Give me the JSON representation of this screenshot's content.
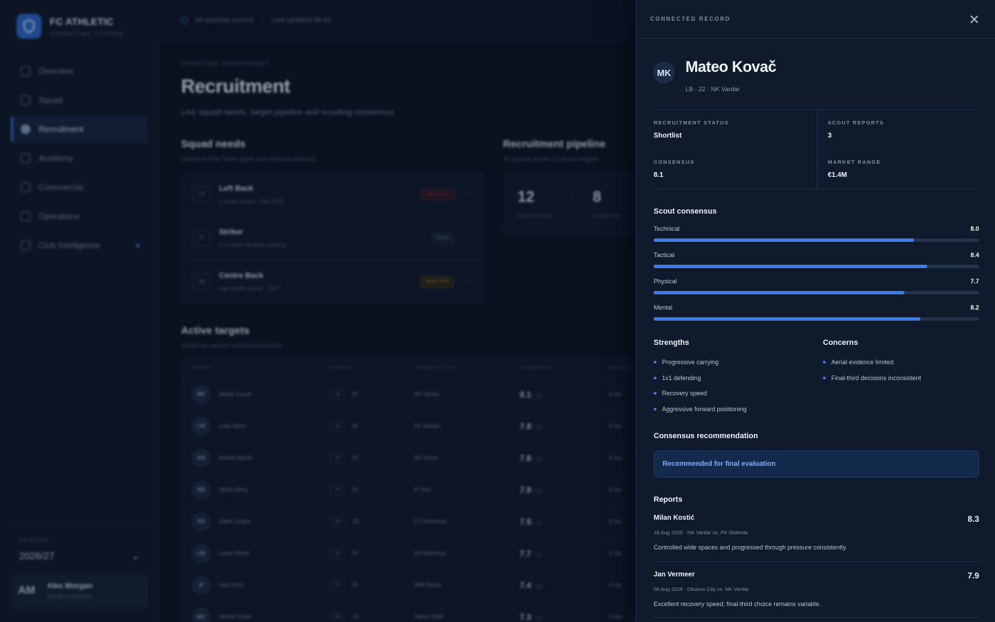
{
  "app": {
    "brand": "FC ATHLETIC",
    "brand_sub": "OPERATING SYSTEM",
    "nav": [
      {
        "label": "Overview"
      },
      {
        "label": "Squad"
      },
      {
        "label": "Recruitment"
      },
      {
        "label": "Academy"
      },
      {
        "label": "Commercial"
      },
      {
        "label": "Operations"
      },
      {
        "label": "Club Intelligence"
      }
    ],
    "season_label": "SEASON",
    "season_value": "2026/27",
    "user": {
      "initials": "AM",
      "name": "Alex Morgan",
      "role": "General Director"
    },
    "topbar": {
      "status": "All systems current",
      "updated": "Last updated 08:42"
    }
  },
  "page": {
    "eyebrow": "SPORTING DEPARTMENT",
    "title": "Recruitment",
    "subtitle": "Live squad needs, target pipeline and scouting consensus"
  },
  "squad_needs": {
    "title": "Squad needs",
    "subtitle": "Linked to First Team depth and contract planning",
    "items": [
      {
        "pos": "LB",
        "title": "Left Back",
        "sub": "1 senior option · Dec 2026",
        "priority": "CRITICAL"
      },
      {
        "pos": "ST",
        "title": "Striker",
        "sub": "1 contract decision pending",
        "priority": "HIGH"
      },
      {
        "pos": "CB",
        "title": "Centre Back",
        "sub": "Age profile review · 2027",
        "priority": "MONITOR"
      }
    ]
  },
  "pipeline": {
    "title": "Recruitment pipeline",
    "subtitle": "31 reports across 12 active targets",
    "stages": [
      {
        "value": "12",
        "label": "IDENTIFIED"
      },
      {
        "value": "8",
        "label": "SCOUTED"
      }
    ]
  },
  "active_targets": {
    "title": "Active targets",
    "subtitle": "Sorted by current recruitment priority",
    "columns": [
      "TARGET",
      "PROFILE",
      "CURRENT CLUB",
      "CONSENSUS",
      "REPORTS"
    ],
    "rows": [
      {
        "initials": "MK",
        "name": "Mateo Kovač",
        "pos": "LB",
        "age": "22",
        "club": "NK Vardar",
        "score": "8.1",
        "of": "/ 10",
        "reports": "3 rep"
      },
      {
        "initials": "LM",
        "name": "Luka Marin",
        "pos": "LB",
        "age": "20",
        "club": "FK Adriatic",
        "score": "7.8",
        "of": "/ 10",
        "reports": "2 rep"
      },
      {
        "initials": "AN",
        "name": "Andrej Nikolić",
        "pos": "ST",
        "age": "23",
        "club": "SK Dunav",
        "score": "7.6",
        "of": "/ 10",
        "reports": "4 rep"
      },
      {
        "initials": "NB",
        "name": "Niklas Berg",
        "pos": "ST",
        "age": "21",
        "club": "IF Vest",
        "score": "7.9",
        "of": "/ 10",
        "reports": "3 rep"
      },
      {
        "initials": "ÁS",
        "name": "Ádám Szabó",
        "pos": "CB",
        "age": "25",
        "club": "FC Pannonia",
        "score": "7.5",
        "of": "/ 10",
        "reports": "3 rep"
      },
      {
        "initials": "LM",
        "name": "Lucas Morel",
        "pos": "LB",
        "age": "24",
        "club": "AS Montreux",
        "score": "7.7",
        "of": "/ 10",
        "reports": "2 rep"
      },
      {
        "initials": "IZ",
        "name": "Ivan Zorić",
        "pos": "ST",
        "age": "26",
        "club": "HNK Borac",
        "score": "7.4",
        "of": "/ 10",
        "reports": "3 rep"
      },
      {
        "initials": "MU",
        "name": "Michal Urban",
        "pos": "CB",
        "age": "22",
        "club": "Tatran 1908",
        "score": "7.3",
        "of": "/ 10",
        "reports": "2 rep"
      }
    ]
  },
  "drawer": {
    "eyebrow": "CONNECTED RECORD",
    "player": {
      "initials": "MK",
      "name": "Mateo Kovač",
      "meta": "LB · 22 · NK Vardar"
    },
    "stats": [
      {
        "label": "RECRUITMENT STATUS",
        "value": "Shortlist"
      },
      {
        "label": "SCOUT REPORTS",
        "value": "3"
      },
      {
        "label": "CONSENSUS",
        "value": "8.1"
      },
      {
        "label": "MARKET RANGE",
        "value": "€1.4M"
      }
    ],
    "consensus_title": "Scout consensus",
    "consensus": [
      {
        "label": "Technical",
        "value": "8.0",
        "fill": 0.8
      },
      {
        "label": "Tactical",
        "value": "8.4",
        "fill": 0.84
      },
      {
        "label": "Physical",
        "value": "7.7",
        "fill": 0.77
      },
      {
        "label": "Mental",
        "value": "8.2",
        "fill": 0.82
      }
    ],
    "strengths_title": "Strengths",
    "strengths": [
      "Progressive carrying",
      "1v1 defending",
      "Recovery speed",
      "Aggressive forward positioning"
    ],
    "concerns_title": "Concerns",
    "concerns": [
      "Aerial evidence limited",
      "Final-third decisions inconsistent"
    ],
    "recommendation_title": "Consensus recommendation",
    "recommendation": "Recommended for final evaluation",
    "reports_title": "Reports",
    "reports": [
      {
        "scout": "Milan Kostić",
        "score": "8.3",
        "meta": "18 Aug 2026 · NK Vardar vs. FK Sloboda",
        "text": "Controlled wide spaces and progressed through pressure consistently."
      },
      {
        "scout": "Jan Vermeer",
        "score": "7.9",
        "meta": "09 Aug 2026 · Dinamo City vs. NK Vardar",
        "text": "Excellent recovery speed; final-third choice remains variable."
      }
    ]
  },
  "colors": {
    "accent": "#3d7be6",
    "critical": "#d44b58",
    "monitor": "#d9a641",
    "drawer_bg": "#0f1a2c"
  }
}
